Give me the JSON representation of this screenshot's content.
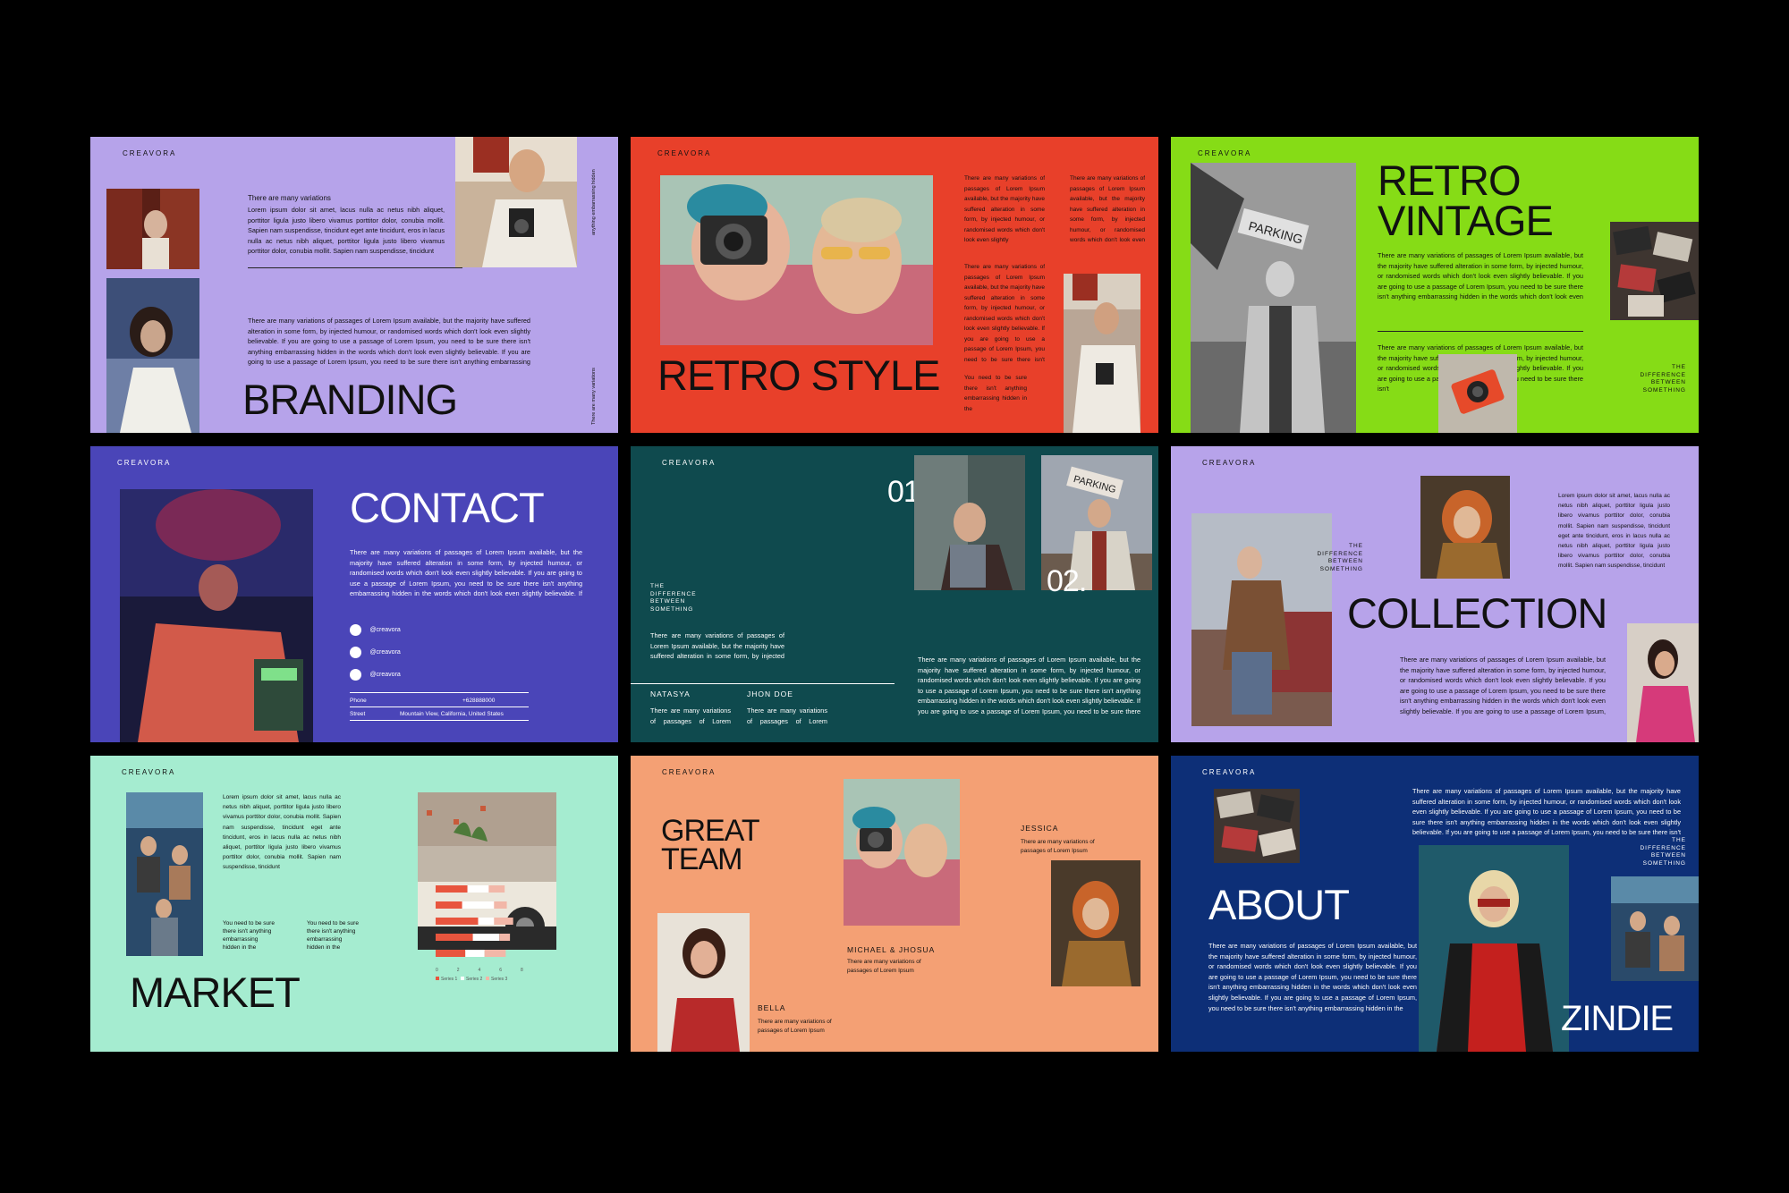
{
  "brand": "CREAVORA",
  "colors": {
    "background": "#000000",
    "branding": "#b6a3ea",
    "retro_style": "#e8402a",
    "retro_vintage": "#86dc16",
    "contact": "#4a45b8",
    "team_dark": "#0f4a4e",
    "collection": "#b7a3ea",
    "market": "#a5ecd0",
    "great_team": "#f4a074",
    "about": "#0d2f77"
  },
  "lorem_long": "There are many variations of passages of Lorem Ipsum available, but the majority have suffered alteration in some form, by injected humour, or randomised words which don't look even slightly believable. If you are going to use a passage of Lorem Ipsum, you need to be sure there isn't anything embarrassing hidden in the words which don't look even slightly believable. If you are going to use a passage of Lorem Ipsum, you need to be sure there isn't anything embarrassing hidden in the",
  "lorem_short": "Lorem ipsum dolor sit amet, lacus nulla ac netus nibh aliquet, porttitor ligula justo libero vivamus porttitor dolor, conubia mollit. Sapien nam suspendisse, tincidunt eget ante tincidunt, eros in lacus nulla ac netus nibh aliquet, porttitor ligula justo libero vivamus porttitor dolor, conubia mollit. Sapien nam suspendisse, tincidunt",
  "branding": {
    "title": "BRANDING",
    "heading": "There are many variations",
    "vertical_1": "anything embarrassing hidden",
    "vertical_2": "There are many variations"
  },
  "retro_style": {
    "title": "RETRO STYLE",
    "col_a": "There are many variations of passages of Lorem Ipsum available, but the majority have suffered alteration in some form, by injected humour, or randomised words which don't look even slightly",
    "col_b": "There are many variations of passages of Lorem Ipsum available, but the majority have suffered alteration in some form, by injected humour, or randomised words which don't look even slightly believable. If you are going to use a passage of Lorem Ipsum, you need to be sure there isn't anything embarrassing hidden in the",
    "col_c": "You need to be sure there isn't anything embarrassing hidden in the",
    "col_d": "There are many variations of passages of Lorem Ipsum available, but the majority have suffered alteration in some form, by injected humour, or randomised words which don't look even slightly believable."
  },
  "retro_vintage": {
    "title_1": "RETRO",
    "title_2": "VINTAGE",
    "body": "There are many variations of passages of Lorem Ipsum available, but the majority have suffered alteration in some form, by injected humour, or randomised words which don't look even slightly believable. If you are going to use a passage of Lorem Ipsum, you need to be sure there isn't anything embarrassing hidden in the words which don't look even slightly believable. If you are going to use a passage of Lorem Ipsum, you need to be sure there isn't anything embarrassing hidden in the",
    "body_2": "There are many variations of passages of Lorem Ipsum available, but the majority have suffered alteration in some form, by injected humour, or randomised words which don't look even slightly believable. If you are going to use a passage of Lorem Ipsum, you need to be sure there isn't",
    "diff": "THE DIFFERENCE BETWEEN SOMETHING"
  },
  "contact": {
    "title": "CONTACT",
    "body": "There are many variations of passages of Lorem Ipsum available, but the majority have suffered alteration in some form, by injected humour, or randomised words which don't look even slightly believable. If you are going to use a passage of Lorem Ipsum, you need to be sure there isn't anything embarrassing hidden in the words which don't look even slightly believable. If you are going to use a passage of Lorem Ipsum, you need to be sure there isn't anything embarrassing hidden in the",
    "social": [
      "@creavora",
      "@creavora",
      "@creavora"
    ],
    "phone_label": "Phone",
    "phone_value": "+628888000",
    "street_label": "Street",
    "street_value": "Mountain View, California, United States"
  },
  "team_dark": {
    "num_1": "01.",
    "num_2": "02.",
    "diff": "THE DIFFERENCE BETWEEN SOMETHING",
    "intro": "There are many variations of passages of Lorem Ipsum available, but the majority have suffered alteration in some form, by injected humour",
    "name_1": "NATASYA",
    "name_2": "JHON DOE",
    "sub": "There are many variations of passages of Lorem Ipsum",
    "body": "There are many variations of passages of Lorem Ipsum available, but the majority have suffered alteration in some form, by injected humour, or randomised words which don't look even slightly believable. If you are going to use a passage of Lorem Ipsum, you need to be sure there isn't anything embarrassing hidden in the words which don't look even slightly believable. If you are going to use a passage of Lorem Ipsum, you need to be sure there isn't anything embarrassing hidden in the"
  },
  "collection": {
    "title": "COLLECTION",
    "diff": "THE DIFFERENCE BETWEEN SOMETHING",
    "side": "Lorem ipsum dolor sit amet, lacus nulla ac netus nibh aliquet, porttitor ligula justo libero vivamus porttitor dolor, conubia mollit. Sapien nam suspendisse, tincidunt eget ante tincidunt, eros in lacus nulla ac netus nibh aliquet, porttitor ligula justo libero vivamus porttitor dolor, conubia mollit. Sapien nam suspendisse, tincidunt",
    "body": "There are many variations of passages of Lorem Ipsum available, but the majority have suffered alteration in some form, by injected humour, or randomised words which don't look even slightly believable. If you are going to use a passage of Lorem Ipsum, you need to be sure there isn't anything embarrassing hidden in the words which don't look even slightly believable. If you are going to use a passage of Lorem Ipsum, you need to be sure there isn't anything embarrassing hidden in the"
  },
  "market": {
    "title": "MARKET",
    "body": "Lorem ipsum dolor sit amet, lacus nulla ac netus nibh aliquet, porttitor ligula justo libero vivamus porttitor dolor, conubia mollit. Sapien nam suspendisse, tincidunt eget ante tincidunt, eros in lacus nulla ac netus nibh aliquet, porttitor ligula justo libero vivamus porttitor dolor, conubia mollit. Sapien nam suspendisse, tincidunt",
    "note_1": "You need to be sure there isn't anything embarrassing hidden in the",
    "note_2": "You need to be sure there isn't anything embarrassing hidden in the"
  },
  "chart_data": {
    "type": "bar",
    "orientation": "horizontal-stacked",
    "categories": [
      "1",
      "2",
      "3",
      "4",
      "5"
    ],
    "x_ticks": [
      "0",
      "2",
      "4",
      "6",
      "8"
    ],
    "series": [
      {
        "name": "Series 1",
        "values": [
          3,
          2.5,
          4,
          3.5,
          2.8
        ],
        "color": "#e8553e"
      },
      {
        "name": "Series 2",
        "values": [
          2,
          3,
          1.5,
          2.5,
          1.8
        ],
        "color": "#ffffff"
      },
      {
        "name": "Series 3",
        "values": [
          1.5,
          1.2,
          1.8,
          1,
          2
        ],
        "color": "#f2b7a8"
      }
    ],
    "legend": "bottom"
  },
  "great_team": {
    "title_1": "GREAT",
    "title_2": "TEAM",
    "name_1": "JESSICA",
    "name_2": "MICHAEL & JHOSUA",
    "name_3": "BELLA",
    "sub": "There are many variations of passages of Lorem Ipsum"
  },
  "about": {
    "title": "ABOUT",
    "name": "ZINDIE",
    "diff": "THE DIFFERENCE BETWEEN SOMETHING",
    "top": "There are many variations of passages of Lorem Ipsum available, but the majority have suffered alteration in some form, by injected humour, or randomised words which don't look even slightly believable. If you are going to use a passage of Lorem Ipsum, you need to be sure there isn't anything embarrassing hidden in the words which don't look even slightly believable. If you are going to use a passage of Lorem Ipsum, you need to be sure there isn't anything embarrassing hidden in the",
    "body": "There are many variations of passages of Lorem Ipsum available, but the majority have suffered alteration in some form, by injected humour, or randomised words which don't look even slightly believable. If you are going to use a passage of Lorem Ipsum, you need to be sure there isn't anything embarrassing hidden in the words which don't look even slightly believable. If you are going to use a passage of Lorem Ipsum, you need to be sure there isn't anything embarrassing hidden in the"
  }
}
